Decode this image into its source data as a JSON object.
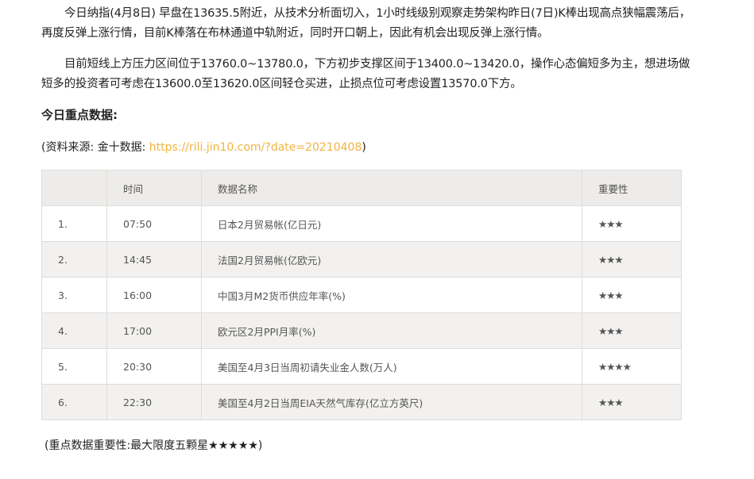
{
  "article": {
    "paragraph_1": "今日纳指(4月8日) 早盘在13635.5附近，从技术分析面切入，1小时线级别观察走势架构昨日(7日)K棒出现高点狭幅震荡后，再度反弹上涨行情，目前K棒落在布林通道中轨附近，同时开口朝上，因此有机会出现反弹上涨行情。",
    "paragraph_2": "目前短线上方压力区间位于13760.0~13780.0，下方初步支撑区间于13400.0~13420.0，操作心态偏短多为主，想进场做短多的投资者可考虑在13600.0至13620.0区间轻仓买进，止损点位可考虑设置13570.0下方。",
    "heading": "今日重点数据:",
    "source_prefix": "(资料来源: 金十数据: ",
    "source_link": "https://rili.jin10.com/?date=20210408",
    "source_suffix": ")",
    "footnote": "(重点数据重要性:最大限度五颗星★★★★★)"
  },
  "table": {
    "headers": [
      "",
      "时间",
      "数据名称",
      "重要性"
    ],
    "rows": [
      {
        "idx": "1.",
        "time": "07:50",
        "name": "日本2月贸易帐(亿日元)",
        "importance": "★★★"
      },
      {
        "idx": "2.",
        "time": "14:45",
        "name": "法国2月贸易帐(亿欧元)",
        "importance": "★★★"
      },
      {
        "idx": "3.",
        "time": "16:00",
        "name": "中国3月M2货币供应年率(%)",
        "importance": "★★★"
      },
      {
        "idx": "4.",
        "time": "17:00",
        "name": "欧元区2月PPI月率(%)",
        "importance": "★★★"
      },
      {
        "idx": "5.",
        "time": "20:30",
        "name": "美国至4月3日当周初请失业金人数(万人)",
        "importance": "★★★★"
      },
      {
        "idx": "6.",
        "time": "22:30",
        "name": "美国至4月2日当周EIA天然气库存(亿立方英尺)",
        "importance": "★★★"
      }
    ]
  },
  "colors": {
    "link": "#f2b33d",
    "header_bg": "#eeecea",
    "stripe_bg": "#f2f1ef",
    "border": "#dddddd"
  }
}
